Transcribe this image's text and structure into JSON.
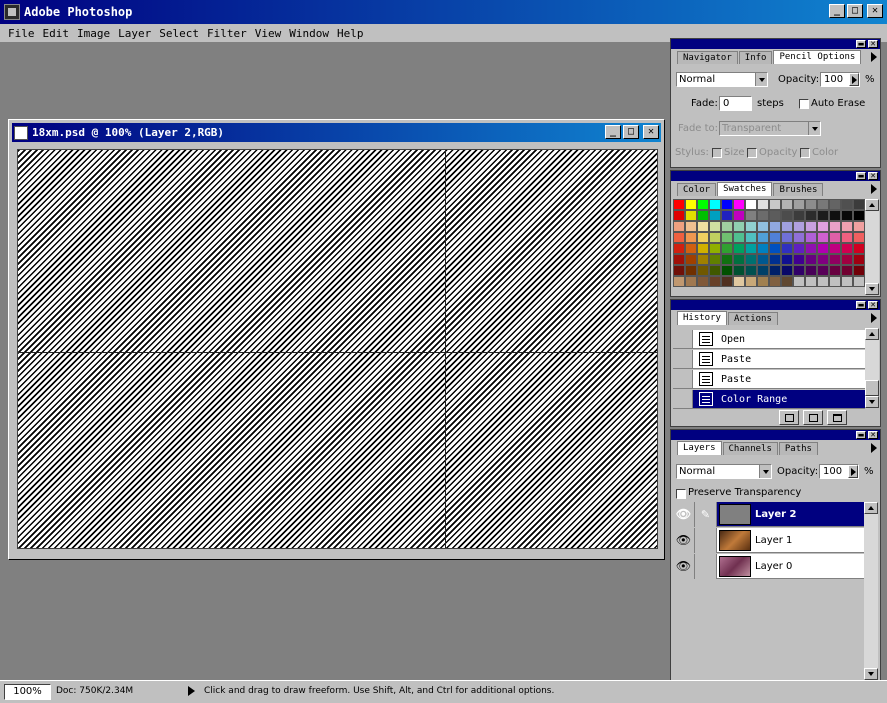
{
  "app": {
    "title": "Adobe Photoshop"
  },
  "window_controls": {
    "minimize": "_",
    "maximize": "□",
    "close": "✕"
  },
  "menu": [
    "File",
    "Edit",
    "Image",
    "Layer",
    "Select",
    "Filter",
    "View",
    "Window",
    "Help"
  ],
  "document": {
    "title": "18xm.psd @ 100% (Layer 2,RGB)"
  },
  "options_panel": {
    "tabs": [
      "Navigator",
      "Info",
      "Pencil Options"
    ],
    "active_tab": 2,
    "blend_mode": "Normal",
    "opacity_label": "Opacity:",
    "opacity_value": "100",
    "opacity_unit": "%",
    "fade_label": "Fade:",
    "fade_value": "0",
    "fade_unit": "steps",
    "auto_erase_label": "Auto Erase",
    "fade_to_label": "Fade to:",
    "fade_to_value": "Transparent",
    "stylus_label": "Stylus:",
    "stylus_size": "Size",
    "stylus_opacity": "Opacity",
    "stylus_color": "Color"
  },
  "swatches_panel": {
    "tabs": [
      "Color",
      "Swatches",
      "Brushes"
    ],
    "active_tab": 1,
    "colors": [
      "#ff0000",
      "#ffff00",
      "#00ff00",
      "#00ffff",
      "#0000ff",
      "#ff00ff",
      "#ffffff",
      "#e0e0e0",
      "#c8c8c8",
      "#b4b4b4",
      "#a0a0a0",
      "#8c8c8c",
      "#787878",
      "#646464",
      "#505050",
      "#3c3c3c",
      "#e00000",
      "#e0e000",
      "#00c000",
      "#00a0c0",
      "#2020c0",
      "#c000c0",
      "#808080",
      "#6c6c6c",
      "#5c5c5c",
      "#4c4c4c",
      "#3c3c3c",
      "#2c2c2c",
      "#1c1c1c",
      "#101010",
      "#080808",
      "#000000",
      "#f0a080",
      "#f0c090",
      "#f0e0a0",
      "#d0e0a0",
      "#a0d0a0",
      "#90d0b0",
      "#90d0d0",
      "#90c0e0",
      "#90a8e0",
      "#a0a0e0",
      "#b0a0e0",
      "#c8a0e0",
      "#e0a0e0",
      "#e8a0c8",
      "#f0a0b0",
      "#f0a0a0",
      "#f06040",
      "#f09850",
      "#f0d060",
      "#c0d060",
      "#70c070",
      "#50c090",
      "#50c0c0",
      "#50a0d8",
      "#5080d8",
      "#7070d8",
      "#9070d8",
      "#b060d8",
      "#d060d0",
      "#e060a8",
      "#f06080",
      "#f06060",
      "#d02010",
      "#d06010",
      "#d0b000",
      "#90b000",
      "#30a030",
      "#00a060",
      "#00a0a0",
      "#0080c0",
      "#0050c0",
      "#3030c0",
      "#6020c0",
      "#9010b0",
      "#b000b0",
      "#c00080",
      "#d00050",
      "#d00020",
      "#a01008",
      "#a04000",
      "#a08000",
      "#608000",
      "#107010",
      "#007040",
      "#007070",
      "#005890",
      "#003090",
      "#101090",
      "#400090",
      "#680080",
      "#800080",
      "#900060",
      "#a00040",
      "#a00010",
      "#701008",
      "#703000",
      "#705800",
      "#405800",
      "#005000",
      "#005030",
      "#005050",
      "#004068",
      "#002068",
      "#080868",
      "#300068",
      "#480058",
      "#580058",
      "#680040",
      "#700030",
      "#700008",
      "#c09870",
      "#a07850",
      "#805838",
      "#684028",
      "#503020",
      "#e0c8a0",
      "#c8a878",
      "#a08050",
      "#806040",
      "#604830",
      "#c0c0c0",
      "#c0c0c0",
      "#c0c0c0",
      "#c0c0c0",
      "#c0c0c0",
      "#c0c0c0"
    ]
  },
  "history_panel": {
    "tabs": [
      "History",
      "Actions"
    ],
    "active_tab": 0,
    "items": [
      "Open",
      "Paste",
      "Paste",
      "Color Range"
    ],
    "selected": 3
  },
  "layers_panel": {
    "tabs": [
      "Layers",
      "Channels",
      "Paths"
    ],
    "active_tab": 0,
    "blend_mode": "Normal",
    "opacity_label": "Opacity:",
    "opacity_value": "100",
    "opacity_unit": "%",
    "preserve_label": "Preserve Transparency",
    "layers": [
      {
        "name": "Layer 2",
        "selected": true,
        "thumb": "#808080"
      },
      {
        "name": "Layer 1",
        "selected": false,
        "thumb": "#7a4a2a"
      },
      {
        "name": "Layer 0",
        "selected": false,
        "thumb": "#9a6080"
      }
    ]
  },
  "status": {
    "zoom": "100%",
    "doc": "Doc: 750K/2.34M",
    "hint": "Click and drag to draw freeform. Use Shift, Alt, and Ctrl for additional options."
  }
}
